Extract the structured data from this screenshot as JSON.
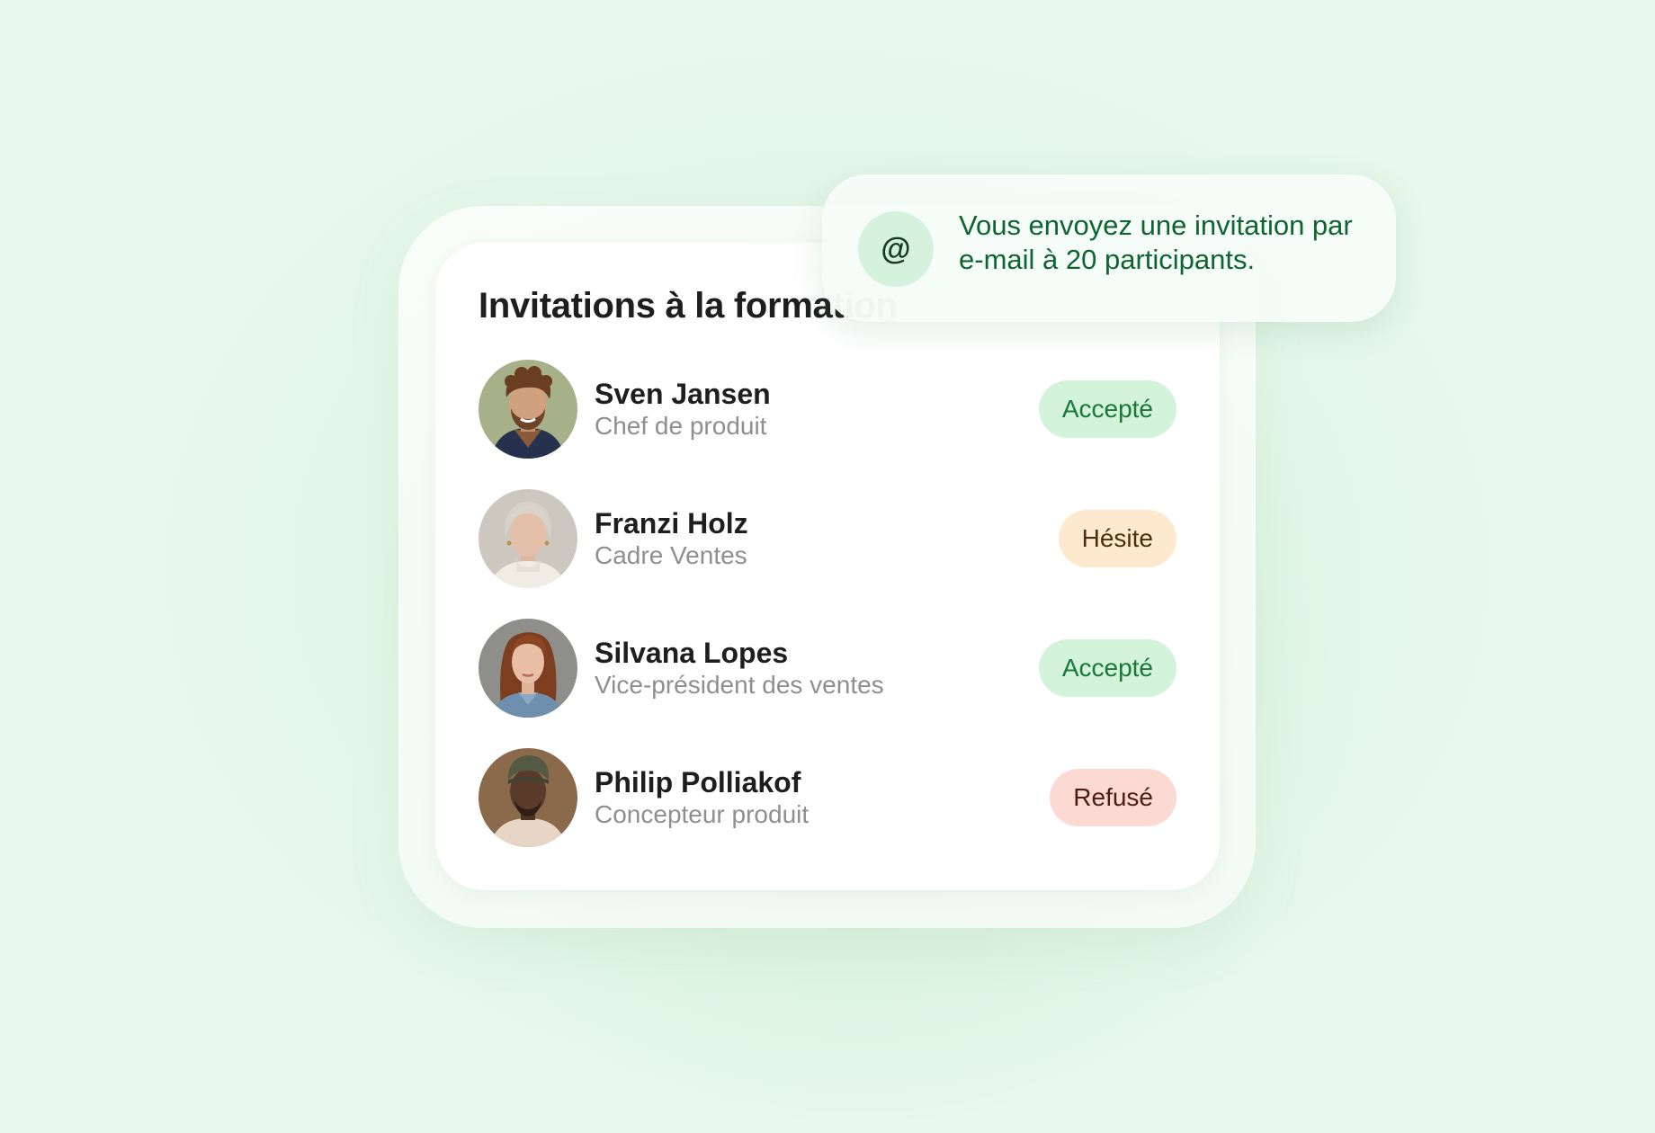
{
  "card": {
    "title": "Invitations à la formation"
  },
  "participants": [
    {
      "name": "Sven Jansen",
      "role": "Chef de produit",
      "status": "Accepté"
    },
    {
      "name": "Franzi Holz",
      "role": "Cadre Ventes",
      "status": "Hésite"
    },
    {
      "name": "Silvana Lopes",
      "role": "Vice-président des ventes",
      "status": "Accepté"
    },
    {
      "name": "Philip Polliakof",
      "role": "Concepteur produit",
      "status": "Refusé"
    }
  ],
  "notification": {
    "icon": "@",
    "message": "Vous envoyez une invitation par e-mail à 20 participants."
  },
  "colors": {
    "accepted_bg": "#d3f4da",
    "accepted_text": "#17783a",
    "hesitant_bg": "#fde9cd",
    "hesitant_text": "#4a2f0c",
    "declined_bg": "#fcd9d3",
    "declined_text": "#4d1b15",
    "notification_text": "#0e6531",
    "background": "#e9f8ec"
  }
}
